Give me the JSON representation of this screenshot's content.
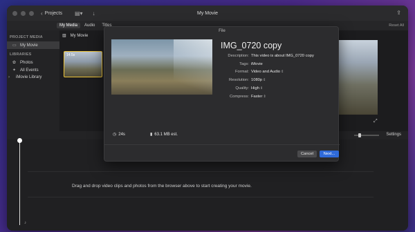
{
  "window": {
    "title": "My Movie",
    "projects_label": "Projects"
  },
  "toolbar": {
    "tabs": [
      {
        "label": "My Media",
        "active": true
      },
      {
        "label": "Audio",
        "active": false
      },
      {
        "label": "Titles",
        "active": false
      }
    ],
    "reset_all": "Reset All"
  },
  "sidebar": {
    "project_media_header": "PROJECT MEDIA",
    "project_item": "My Movie",
    "libraries_header": "LIBRARIES",
    "items": [
      {
        "label": "Photos",
        "icon": "photos-icon"
      },
      {
        "label": "All Events",
        "icon": "star-icon"
      },
      {
        "label": "iMovie Library",
        "icon": "chevron-right-icon"
      }
    ]
  },
  "browser": {
    "title": "My Movie",
    "clip_duration": "14.5s"
  },
  "viewbar": {
    "settings_label": "Settings"
  },
  "timeline": {
    "placeholder": "Drag and drop video clips and photos from the browser above to start creating your movie."
  },
  "dialog": {
    "title": "File",
    "name": "IMG_0720 copy",
    "fields": [
      {
        "label": "Description:",
        "value": "This video is about IMG_0720 copy",
        "dropdown": false
      },
      {
        "label": "Tags:",
        "value": "iMovie",
        "dropdown": false
      },
      {
        "label": "Format:",
        "value": "Video and Audio",
        "dropdown": true
      },
      {
        "label": "Resolution:",
        "value": "1080p",
        "dropdown": true
      },
      {
        "label": "Quality:",
        "value": "High",
        "dropdown": true
      },
      {
        "label": "Compress:",
        "value": "Faster",
        "dropdown": true
      }
    ],
    "duration": "24s",
    "size": "63.1 MB est.",
    "cancel_label": "Cancel",
    "next_label": "Next..."
  }
}
